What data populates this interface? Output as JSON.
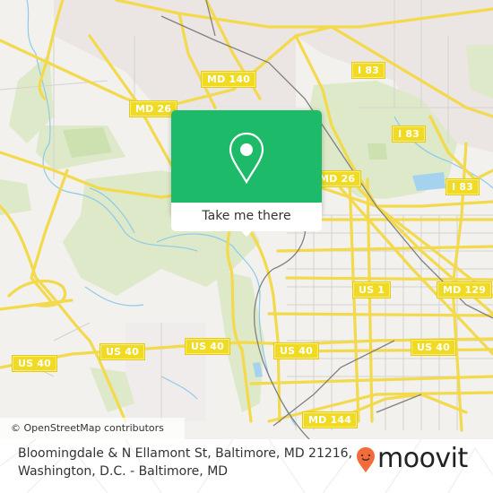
{
  "map": {
    "colors": {
      "background": "#f2f1ee",
      "urban": "#e9e4e2",
      "park": "#dbe9c6",
      "park_dark": "#c8df aa",
      "water": "#9fd0ee",
      "road_major": "#f5dc4e",
      "road_minor": "#d4d0cc",
      "rail": "#7a7a7a"
    },
    "road_labels": [
      {
        "id": "md140",
        "text": "MD 140"
      },
      {
        "id": "i83-top",
        "text": "I 83"
      },
      {
        "id": "i83-mid",
        "text": "I 83"
      },
      {
        "id": "i83-right",
        "text": "I 83"
      },
      {
        "id": "md26-left",
        "text": "MD 26"
      },
      {
        "id": "md26-center",
        "text": "MD 26"
      },
      {
        "id": "md129",
        "text": "MD 129"
      },
      {
        "id": "us1",
        "text": "US 1"
      },
      {
        "id": "us40-far-left",
        "text": "US 40"
      },
      {
        "id": "us40-left",
        "text": "US 40"
      },
      {
        "id": "us40-center",
        "text": "US 40"
      },
      {
        "id": "us40-mid",
        "text": "US 40"
      },
      {
        "id": "us40-right",
        "text": "US 40"
      },
      {
        "id": "md144",
        "text": "MD 144"
      }
    ],
    "attribution": "© OpenStreetMap contributors"
  },
  "popup": {
    "icon": "map-pin-icon",
    "button_label": "Take me there",
    "color": "#1dba69"
  },
  "footer": {
    "address_line1": "Bloomingdale & N Ellamont St, Baltimore, MD 21216,",
    "address_line2": "Washington, D.C. - Baltimore, MD",
    "brand_name": "moovit",
    "brand_icon": "moovit-pin-icon",
    "brand_color": "#f26b3a"
  }
}
